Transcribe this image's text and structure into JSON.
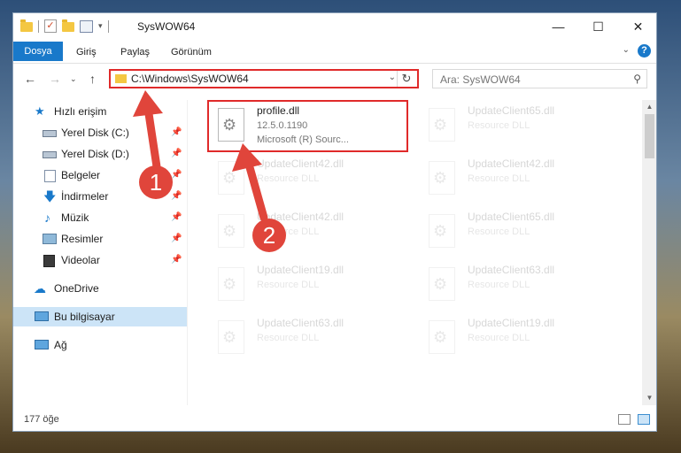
{
  "window": {
    "title": "SysWOW64",
    "controls": {
      "minimize": "—",
      "maximize": "☐",
      "close": "✕"
    }
  },
  "ribbon": {
    "tabs": [
      {
        "label": "Dosya",
        "active": true
      },
      {
        "label": "Giriş"
      },
      {
        "label": "Paylaş"
      },
      {
        "label": "Görünüm"
      }
    ],
    "help": "?"
  },
  "address": {
    "path": "C:\\Windows\\SysWOW64",
    "search_placeholder": "Ara: SysWOW64"
  },
  "sidebar": {
    "items": [
      {
        "label": "Hızlı erişim",
        "icon": "star-icon",
        "pinned": false
      },
      {
        "label": "Yerel Disk (C:)",
        "icon": "drive-icon",
        "pinned": true
      },
      {
        "label": "Yerel Disk (D:)",
        "icon": "drive-icon",
        "pinned": true
      },
      {
        "label": "Belgeler",
        "icon": "documents-icon",
        "pinned": true
      },
      {
        "label": "İndirmeler",
        "icon": "download-icon",
        "pinned": true
      },
      {
        "label": "Müzik",
        "icon": "music-icon",
        "pinned": true
      },
      {
        "label": "Resimler",
        "icon": "pictures-icon",
        "pinned": true
      },
      {
        "label": "Videolar",
        "icon": "videos-icon",
        "pinned": true
      },
      {
        "label": "OneDrive",
        "icon": "cloud-icon"
      },
      {
        "label": "Bu bilgisayar",
        "icon": "computer-icon",
        "selected": true
      },
      {
        "label": "Ağ",
        "icon": "network-icon"
      }
    ]
  },
  "files": {
    "highlighted": {
      "name": "profile.dll",
      "version": "12.5.0.1190",
      "company": "Microsoft (R) Sourc..."
    },
    "faded_type": "Resource DLL",
    "faded_names": [
      "UpdateClient65.dll",
      "UpdateClient42.dll",
      "UpdateClient42.dll",
      "UpdateClient42.dll",
      "UpdateClient65.dll",
      "UpdateClient19.dll",
      "UpdateClient63.dll",
      "UpdateClient63.dll",
      "UpdateClient19.dll"
    ]
  },
  "status": {
    "count": "177 öğe"
  },
  "annotations": {
    "badge1": "1",
    "badge2": "2"
  },
  "colors": {
    "accent": "#1979ca",
    "highlight": "#e02a2a",
    "arrow": "#e0453b"
  }
}
